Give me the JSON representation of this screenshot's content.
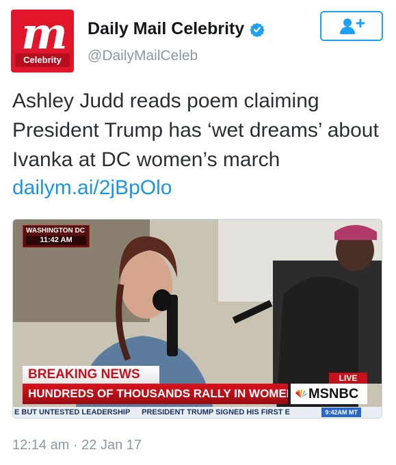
{
  "account": {
    "display_name": "Daily Mail Celebrity",
    "handle": "@DailyMailCeleb",
    "avatar_mark": "m",
    "avatar_badge": "Celebrity",
    "verified_icon": "verified-badge-icon",
    "follow_icon": "add-user-icon"
  },
  "tweet": {
    "text": "Ashley Judd reads poem claiming President Trump has ‘wet dreams’ about Ivanka at DC women’s march",
    "link": "dailym.ai/2jBpOlo",
    "timestamp": "12:14 am · 22 Jan 17"
  },
  "media": {
    "location": "WASHINGTON DC",
    "time": "11:42 AM",
    "breaking": "BREAKING NEWS",
    "headline": "HUNDREDS OF THOUSANDS RALLY IN WOMEN'S MARCHES",
    "live": "LIVE",
    "network": "MSNBC",
    "ticker": "E BUT UNTESTED LEADERSHIP",
    "ticker_2": "PRESIDENT TRUMP SIGNED HIS FIRST E",
    "ticker_clock": "9:42AM MT"
  },
  "colors": {
    "accent": "#1da1f2",
    "link": "#1b95e0",
    "brand_red": "#e2162a",
    "muted": "#8899a6"
  }
}
